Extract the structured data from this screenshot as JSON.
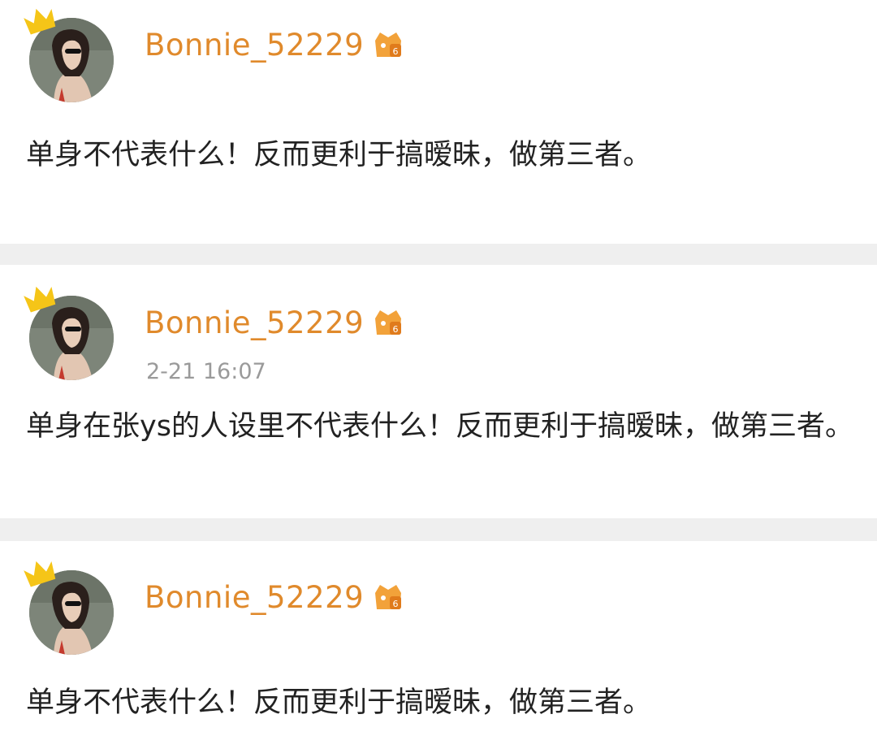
{
  "posts": [
    {
      "username": "Bonnie_52229",
      "timestamp": "",
      "text": "单身不代表什么！反而更利于搞暧昧，做第三者。"
    },
    {
      "username": "Bonnie_52229",
      "timestamp": "2-21 16:07",
      "text": "单身在张ys的人设里不代表什么！反而更利于搞暧昧，做第三者。"
    },
    {
      "username": "Bonnie_52229",
      "timestamp": "",
      "text": "单身不代表什么！反而更利于搞暧昧，做第三者。"
    }
  ],
  "colors": {
    "username": "#e08a2c",
    "crown": "#f5c518",
    "timestamp": "#9a9a9a",
    "divider": "#efefef",
    "text": "#222222"
  },
  "icons": {
    "crown": "crown-icon",
    "badge": "vip-badge-icon",
    "avatar": "avatar"
  }
}
